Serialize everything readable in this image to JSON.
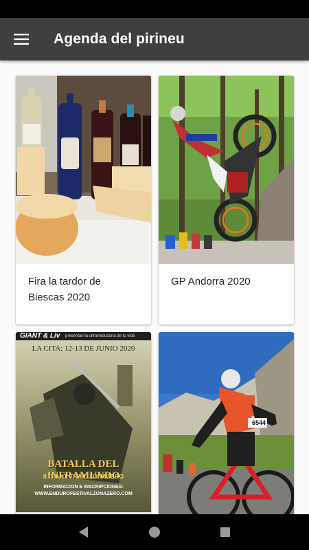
{
  "app": {
    "title": "Agenda del pirineu"
  },
  "events": [
    {
      "title": "Fira la tardor de Biescas 2020",
      "image": "cheese-and-wine-photo"
    },
    {
      "title": "GP Andorra 2020",
      "image": "trial-motorbike-photo"
    },
    {
      "title": "",
      "image": "batalla-del-inframundo-poster",
      "poster": {
        "brands": "GIANT & Liv",
        "tagline": "presentan la ultrarreductora de tu vida",
        "date": "LA CITA: 12-13 DE JUNIO 2020",
        "headline": "BATALLA DEL INFRAMUNDO",
        "subheadline": "II GIANT TRAIL ZONAZERO",
        "info": "INFORMACION E INSCRIPCIONES:",
        "url": "WWW.ENDUROFESTIVALZONAZERO.COM"
      }
    },
    {
      "title": "",
      "image": "road-cyclist-photo",
      "bib": "6544"
    }
  ],
  "colors": {
    "app_bar": "#3f3f3f",
    "background": "#fafafa",
    "card": "#ffffff"
  }
}
